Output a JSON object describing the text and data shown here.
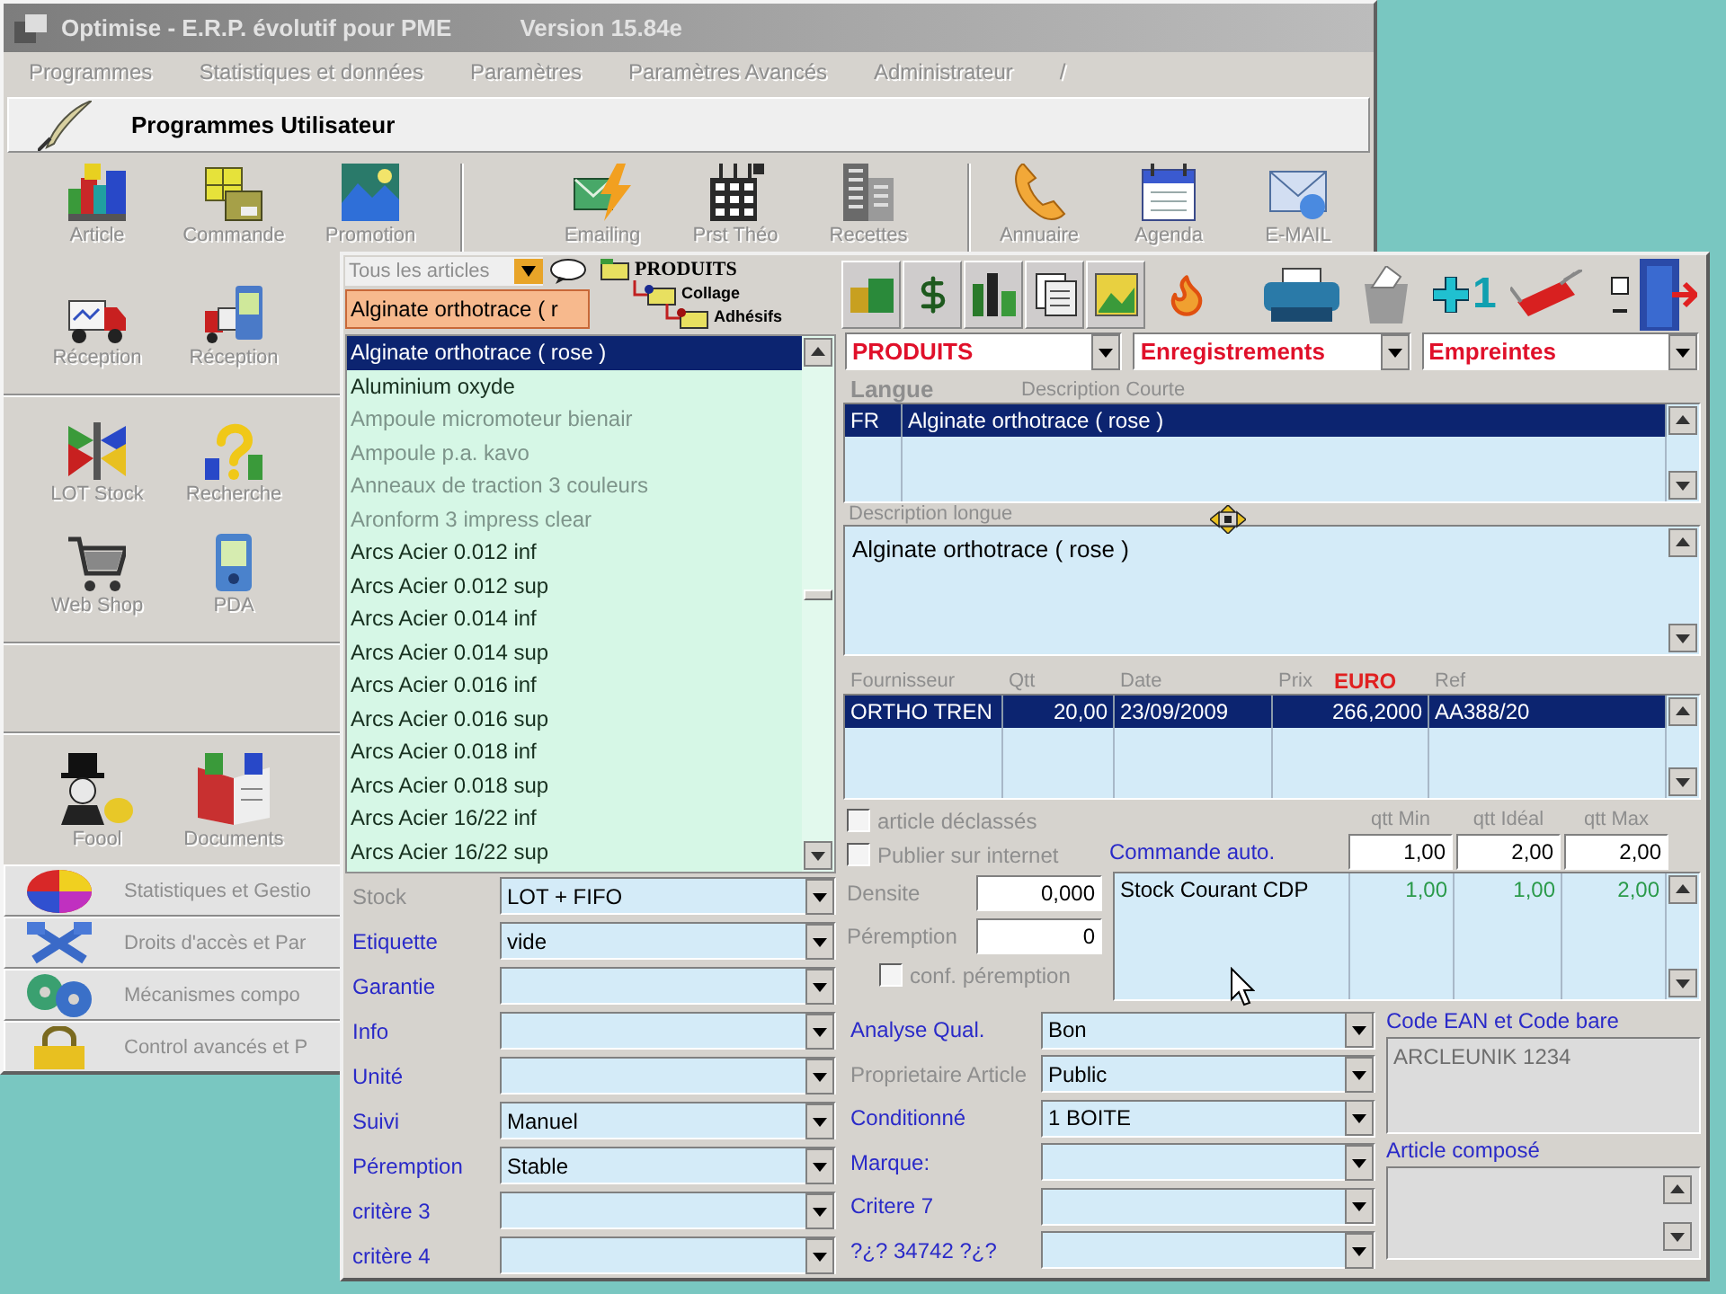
{
  "back_window": {
    "title": "Optimise - E.R.P. évolutif pour PME",
    "version": "Version 15.84e",
    "menu": [
      {
        "label": "Programmes",
        "disabled": true
      },
      {
        "label": "Statistiques et données",
        "disabled": true
      },
      {
        "label": "Paramètres",
        "disabled": true
      },
      {
        "label": "Paramètres Avancés",
        "disabled": true
      },
      {
        "label": "Administrateur",
        "disabled": true
      },
      {
        "label": "/",
        "disabled": true
      }
    ],
    "panel_title": "Programmes Utilisateur",
    "toolbar_groups": [
      [
        {
          "label": "Article",
          "disabled": true
        },
        {
          "label": "Commande",
          "disabled": true
        },
        {
          "label": "Promotion",
          "disabled": true
        }
      ],
      [
        {
          "label": "Emailing",
          "disabled": true
        },
        {
          "label": "Prst Théo",
          "disabled": true
        },
        {
          "label": "Recettes",
          "disabled": true
        }
      ],
      [
        {
          "label": "Annuaire",
          "disabled": true
        },
        {
          "label": "Agenda",
          "disabled": true
        },
        {
          "label": "E-MAIL",
          "disabled": true
        }
      ]
    ],
    "shortcut_rows": [
      [
        {
          "label": "Réception",
          "disabled": true
        },
        {
          "label": "Réception",
          "disabled": true
        }
      ],
      [
        {
          "label": "LOT Stock",
          "disabled": true
        },
        {
          "label": "Recherche",
          "disabled": true
        }
      ],
      [
        {
          "label": "Web Shop",
          "disabled": true
        },
        {
          "label": "PDA",
          "disabled": true
        }
      ]
    ],
    "more_shortcuts": [
      {
        "label": "Foool",
        "disabled": true
      },
      {
        "label": "Documents",
        "disabled": true
      }
    ],
    "sections": [
      {
        "label": "Statistiques et Gestio",
        "disabled": true
      },
      {
        "label": "Droits d'accès et Par",
        "disabled": true
      },
      {
        "label": "Mécanismes compo",
        "disabled": true
      },
      {
        "label": "Control avancés et P",
        "disabled": true
      }
    ]
  },
  "article_window": {
    "filter": {
      "value": "Tous les articles"
    },
    "category_tree": [
      {
        "label": "PRODUITS",
        "children": [
          {
            "label": "Collage",
            "children": [
              {
                "label": "Adhésifs"
              }
            ]
          }
        ]
      }
    ],
    "search": {
      "value": "Alginate orthotrace ( r"
    },
    "articles": [
      {
        "label": "Alginate orthotrace ( rose )",
        "selected": true,
        "disabled": false
      },
      {
        "label": "Aluminium oxyde",
        "selected": false,
        "disabled": false
      },
      {
        "label": "Ampoule micromoteur bienair",
        "selected": false,
        "disabled": true
      },
      {
        "label": "Ampoule p.a. kavo",
        "selected": false,
        "disabled": true
      },
      {
        "label": "Anneaux de traction 3 couleurs",
        "selected": false,
        "disabled": true
      },
      {
        "label": "Aronform 3 impress clear",
        "selected": false,
        "disabled": true
      },
      {
        "label": "Arcs Acier 0.012 inf",
        "selected": false,
        "disabled": false
      },
      {
        "label": "Arcs Acier 0.012 sup",
        "selected": false,
        "disabled": false
      },
      {
        "label": "Arcs Acier 0.014 inf",
        "selected": false,
        "disabled": false
      },
      {
        "label": "Arcs Acier 0.014 sup",
        "selected": false,
        "disabled": false
      },
      {
        "label": "Arcs Acier 0.016 inf",
        "selected": false,
        "disabled": false
      },
      {
        "label": "Arcs Acier 0.016 sup",
        "selected": false,
        "disabled": false
      },
      {
        "label": "Arcs Acier 0.018 inf",
        "selected": false,
        "disabled": false
      },
      {
        "label": "Arcs Acier 0.018 sup",
        "selected": false,
        "disabled": false
      },
      {
        "label": "Arcs Acier 16/22 inf",
        "selected": false,
        "disabled": false
      },
      {
        "label": "Arcs Acier 16/22 sup",
        "selected": false,
        "disabled": false
      }
    ],
    "attributes": [
      {
        "label": "Stock",
        "disabled": true,
        "value": "LOT + FIFO"
      },
      {
        "label": "Etiquette",
        "disabled": false,
        "value": "vide"
      },
      {
        "label": "Garantie",
        "disabled": false
      },
      {
        "label": "Info",
        "disabled": false
      },
      {
        "label": "Unité",
        "disabled": false
      },
      {
        "label": "Suivi",
        "disabled": false,
        "value": "Manuel"
      },
      {
        "label": "Péremption",
        "disabled": false,
        "value": "Stable"
      },
      {
        "label": "critère 3",
        "disabled": false
      },
      {
        "label": "critère 4",
        "disabled": false
      }
    ],
    "increment_button": {
      "label": "1"
    },
    "selectors": [
      {
        "value": "PRODUITS"
      },
      {
        "value": "Enregistrements"
      },
      {
        "value": "Empreintes"
      }
    ],
    "descriptions": {
      "columns": [
        "Langue",
        "Description Courte"
      ],
      "rows": [
        {
          "cells": [
            "FR",
            "Alginate orthotrace ( rose )"
          ],
          "selected": true
        }
      ]
    },
    "long_description": {
      "label": "Description longue",
      "value": "Alginate orthotrace ( rose )"
    },
    "suppliers": {
      "columns": [
        "Fournisseur",
        "Qtt",
        "Date",
        "Prix",
        "Ref"
      ],
      "currency": "EURO",
      "rows": [
        {
          "cells": [
            "ORTHO TREN",
            "20,00",
            "23/09/2009",
            "266,2000",
            "AA388/20"
          ],
          "selected": true
        }
      ]
    },
    "options": [
      {
        "label": "article déclassés",
        "checked": false,
        "disabled": true
      },
      {
        "label": "Publier sur internet",
        "checked": false,
        "disabled": true
      }
    ],
    "density": {
      "label": "Densite",
      "value": "0,000",
      "disabled": true
    },
    "expiry": {
      "label": "Péremption",
      "value": "0",
      "disabled": true
    },
    "expiry_confirm": {
      "label": "conf. péremption",
      "checked": false,
      "disabled": true
    },
    "auto_order": {
      "label": "Commande auto.",
      "columns": [
        "qtt Min",
        "qtt Idéal",
        "qtt Max"
      ],
      "values": [
        "1,00",
        "2,00",
        "2,00"
      ]
    },
    "stock_rows": [
      {
        "name": "Stock Courant CDP",
        "values": [
          "1,00",
          "1,00",
          "2,00"
        ]
      }
    ],
    "properties": [
      {
        "label": "Analyse Qual.",
        "disabled": false,
        "value": "Bon"
      },
      {
        "label": "Proprietaire Article",
        "disabled": true,
        "value": "Public"
      },
      {
        "label": "Conditionné",
        "disabled": false,
        "value": "1 BOITE"
      },
      {
        "label": "Marque:",
        "disabled": false
      },
      {
        "label": "Critere 7",
        "disabled": false
      },
      {
        "label": "?¿? 34742 ?¿?",
        "disabled": false
      }
    ],
    "barcode": {
      "label": "Code EAN et Code bare",
      "value": "ARCLEUNIK 1234",
      "disabled": true
    },
    "composite": {
      "label": "Article composé"
    }
  }
}
